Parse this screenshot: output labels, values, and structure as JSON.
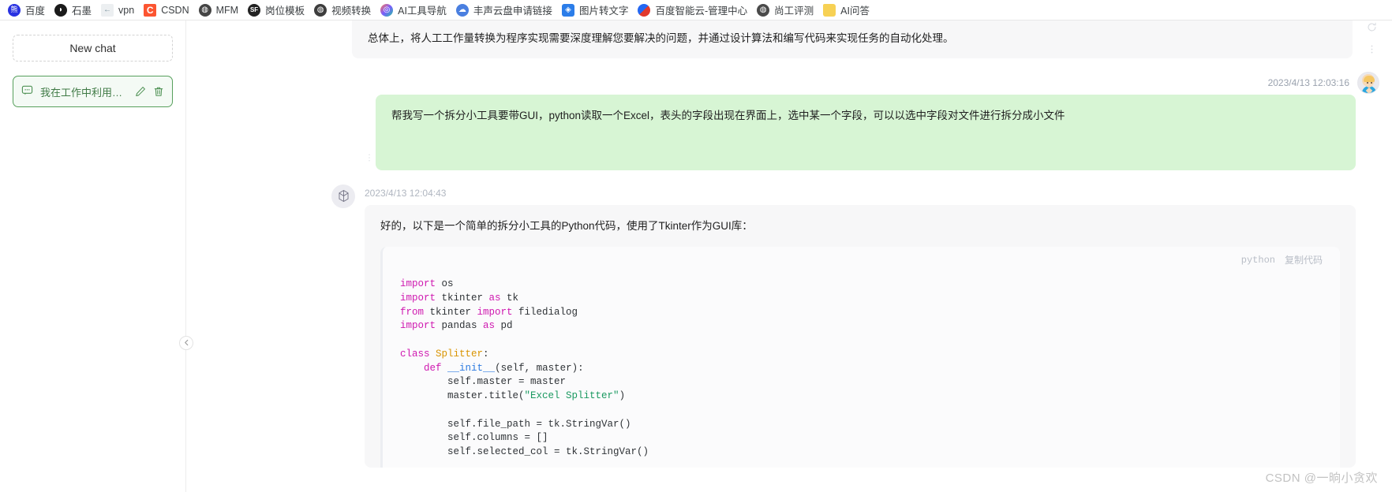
{
  "bookmarks": [
    {
      "label": "百度",
      "icon": "baidu-icon",
      "glyph": "熊",
      "cls": "ico-baidu"
    },
    {
      "label": "石墨",
      "icon": "shimo-icon",
      "glyph": "◗",
      "cls": "ico-shimo"
    },
    {
      "label": "vpn",
      "icon": "vpn-icon",
      "glyph": "←",
      "cls": "ico-vpn"
    },
    {
      "label": "CSDN",
      "icon": "csdn-icon",
      "glyph": "C",
      "cls": "ico-csdn"
    },
    {
      "label": "MFM",
      "icon": "mfm-icon",
      "glyph": "◍",
      "cls": "ico-mfm"
    },
    {
      "label": "岗位模板",
      "icon": "job-template-icon",
      "glyph": "SF",
      "cls": "ico-gw"
    },
    {
      "label": "视频转换",
      "icon": "video-convert-icon",
      "glyph": "◍",
      "cls": "ico-video"
    },
    {
      "label": "AI工具导航",
      "icon": "ai-tools-icon",
      "glyph": "◎",
      "cls": "ico-ai"
    },
    {
      "label": "丰声云盘申请链接",
      "icon": "cloud-disk-icon",
      "glyph": "☁",
      "cls": "ico-fs"
    },
    {
      "label": "图片转文字",
      "icon": "image-to-text-icon",
      "glyph": "◈",
      "cls": "ico-img"
    },
    {
      "label": "百度智能云-管理中心",
      "icon": "baidu-cloud-icon",
      "glyph": "",
      "cls": "ico-bdcloud"
    },
    {
      "label": "尚工评测",
      "icon": "shanggong-icon",
      "glyph": "◍",
      "cls": "ico-sg"
    },
    {
      "label": "AI问答",
      "icon": "folder-icon",
      "glyph": "",
      "cls": "ico-folder"
    }
  ],
  "sidebar": {
    "new_chat_label": "New chat",
    "chat_items": [
      {
        "title": "我在工作中利用pyt...",
        "edit_label": "编辑",
        "delete_label": "删除"
      }
    ]
  },
  "conversation": {
    "assistant_partial": {
      "text": "总体上，将人工工作量转换为程序实现需要深度理解您要解决的问题，并通过设计算法和编写代码来实现任务的自动化处理。"
    },
    "user_message": {
      "timestamp": "2023/4/13 12:03:16",
      "text": "帮我写一个拆分小工具要带GUI，python读取一个Excel，表头的字段出现在界面上，选中某一个字段，可以以选中字段对文件进行拆分成小文件"
    },
    "assistant_message": {
      "timestamp": "2023/4/13 12:04:43",
      "text": "好的，以下是一个简单的拆分小工具的Python代码，使用了Tkinter作为GUI库：",
      "code_block": {
        "language": "python",
        "copy_label": "复制代码",
        "lines": [
          [
            {
              "t": "import",
              "c": "k"
            },
            {
              "t": " os",
              "c": "pl"
            }
          ],
          [
            {
              "t": "import",
              "c": "k"
            },
            {
              "t": " tkinter ",
              "c": "pl"
            },
            {
              "t": "as",
              "c": "k"
            },
            {
              "t": " tk",
              "c": "pl"
            }
          ],
          [
            {
              "t": "from",
              "c": "k"
            },
            {
              "t": " tkinter ",
              "c": "pl"
            },
            {
              "t": "import",
              "c": "k"
            },
            {
              "t": " filedialog",
              "c": "pl"
            }
          ],
          [
            {
              "t": "import",
              "c": "k"
            },
            {
              "t": " pandas ",
              "c": "pl"
            },
            {
              "t": "as",
              "c": "k"
            },
            {
              "t": " pd",
              "c": "pl"
            }
          ],
          [
            {
              "t": "",
              "c": "pl"
            }
          ],
          [
            {
              "t": "class",
              "c": "k"
            },
            {
              "t": " ",
              "c": "pl"
            },
            {
              "t": "Splitter",
              "c": "cls"
            },
            {
              "t": ":",
              "c": "pl"
            }
          ],
          [
            {
              "t": "    ",
              "c": "pl"
            },
            {
              "t": "def",
              "c": "k"
            },
            {
              "t": " ",
              "c": "pl"
            },
            {
              "t": "__init__",
              "c": "fn"
            },
            {
              "t": "(self, master):",
              "c": "pl"
            }
          ],
          [
            {
              "t": "        self.master = master",
              "c": "pl"
            }
          ],
          [
            {
              "t": "        master.title(",
              "c": "pl"
            },
            {
              "t": "\"Excel Splitter\"",
              "c": "s"
            },
            {
              "t": ")",
              "c": "pl"
            }
          ],
          [
            {
              "t": "",
              "c": "pl"
            }
          ],
          [
            {
              "t": "        self.file_path = tk.StringVar()",
              "c": "pl"
            }
          ],
          [
            {
              "t": "        self.columns = []",
              "c": "pl"
            }
          ],
          [
            {
              "t": "        self.selected_col = tk.StringVar()",
              "c": "pl"
            }
          ]
        ]
      }
    }
  },
  "watermark": "CSDN @一晌小贪欢",
  "colors": {
    "user_bubble": "#d7f5d4",
    "assistant_bubble": "#f7f7f8",
    "accent_green": "#57a05c",
    "code_keyword": "#cf19b0",
    "code_string": "#1a9960",
    "code_class": "#d99400",
    "code_function": "#2b7ae0"
  }
}
